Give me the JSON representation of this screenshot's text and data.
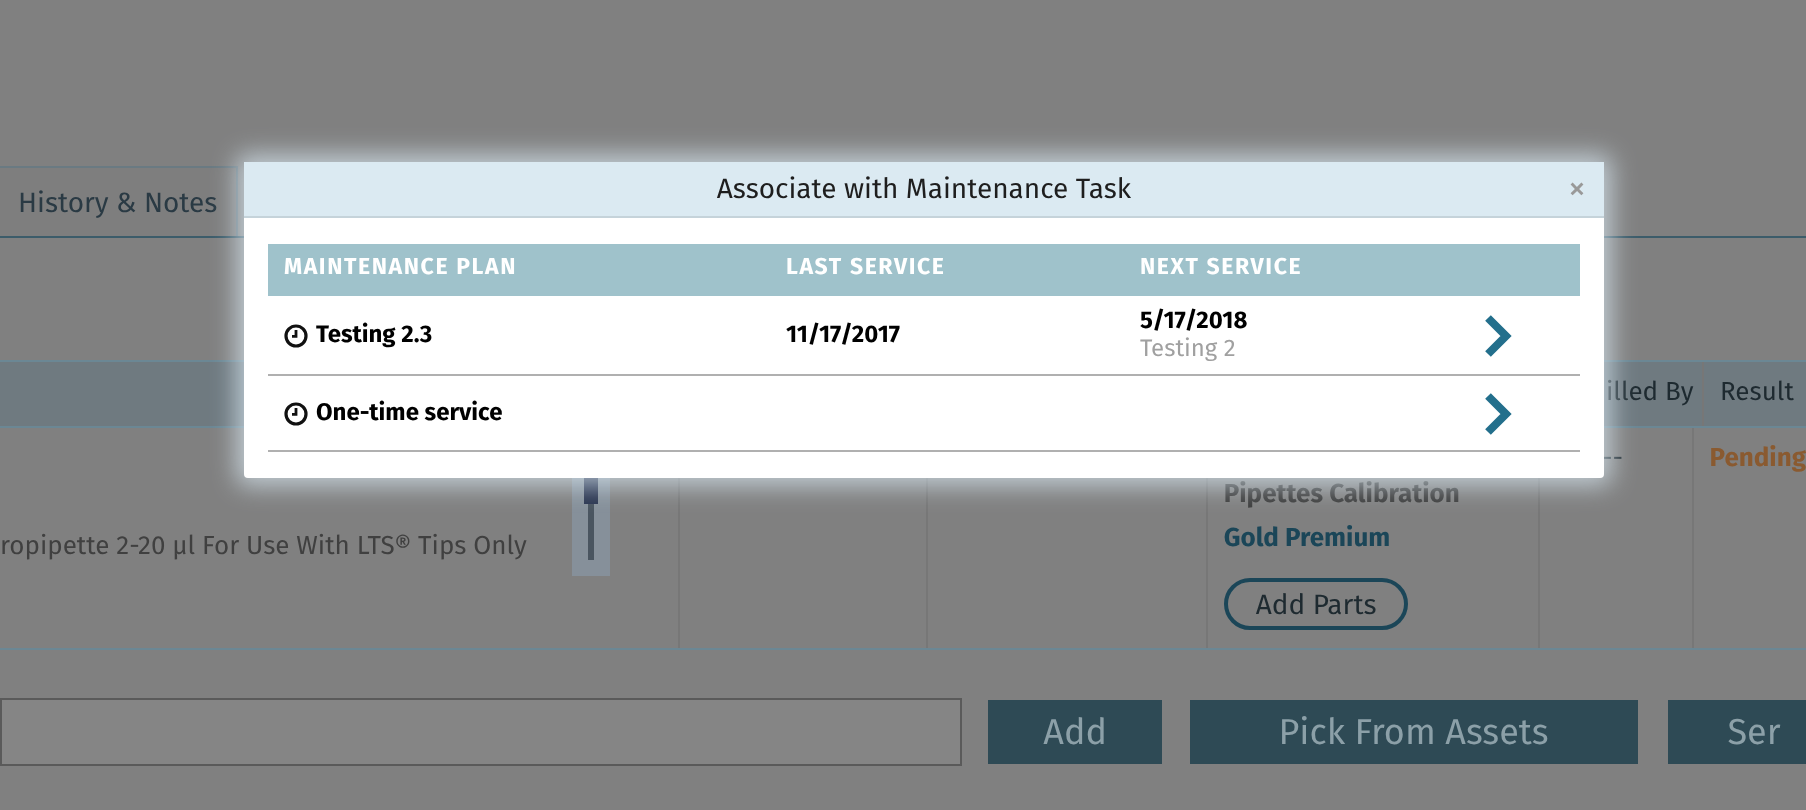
{
  "background": {
    "tabs": [
      {
        "label": "History & Notes",
        "selected": false
      }
    ],
    "table": {
      "columns": [
        "illed By",
        "Result"
      ],
      "row": {
        "description": "ropipette 2-20 µl For Use With LTS® Tips Only",
        "plan_type": "Pipettes Calibration",
        "plan_level": "Gold Premium",
        "add_parts": "Add Parts",
        "filled_by": "--",
        "result": "Pending"
      }
    },
    "buttons": [
      "Add",
      "Pick From Assets",
      "Ser"
    ]
  },
  "dialog": {
    "title": "Associate with Maintenance Task",
    "close": "×",
    "columns": [
      "MAINTENANCE PLAN",
      "LAST SERVICE",
      "NEXT SERVICE"
    ],
    "rows": [
      {
        "plan": "Testing 2.3",
        "last_service": "11/17/2017",
        "next_service": "5/17/2018",
        "next_task": "Testing 2"
      },
      {
        "plan": "One-time service"
      }
    ]
  }
}
